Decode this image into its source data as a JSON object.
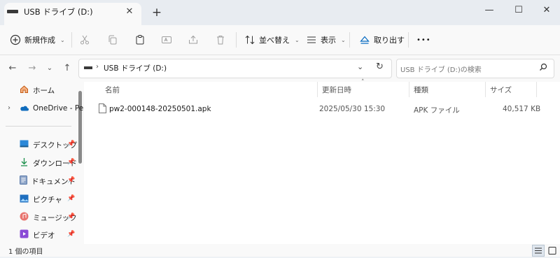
{
  "window": {
    "tab_title": "USB ドライブ (D:)",
    "new_tab": "+",
    "minimize": "—",
    "maximize": "☐",
    "close": "✕"
  },
  "toolbar": {
    "new_label": "新規作成",
    "sort_label": "並べ替え",
    "view_label": "表示",
    "eject_label": "取り出す",
    "more_label": "•••"
  },
  "address": {
    "path": "USB ドライブ (D:)",
    "search_placeholder": "USB ドライブ (D:)の検索"
  },
  "nav": {
    "home": "ホーム",
    "onedrive": "OneDrive - Pers",
    "items": [
      {
        "label": "デスクトップ",
        "icon": "desktop-icon"
      },
      {
        "label": "ダウンロード",
        "icon": "download-icon"
      },
      {
        "label": "ドキュメント",
        "icon": "document-icon"
      },
      {
        "label": "ピクチャ",
        "icon": "pictures-icon"
      },
      {
        "label": "ミュージック",
        "icon": "music-icon"
      },
      {
        "label": "ビデオ",
        "icon": "video-icon"
      }
    ]
  },
  "columns": {
    "name": "名前",
    "modified": "更新日時",
    "type": "種類",
    "size": "サイズ"
  },
  "files": [
    {
      "name": "pw2-000148-20250501.apk",
      "modified": "2025/05/30 15:30",
      "type": "APK ファイル",
      "size": "40,517 KB"
    }
  ],
  "status": {
    "count": "1 個の項目"
  },
  "colors": {
    "accent": "#0067c0",
    "background": "#eef1f5",
    "pane": "#f9f9f9"
  }
}
